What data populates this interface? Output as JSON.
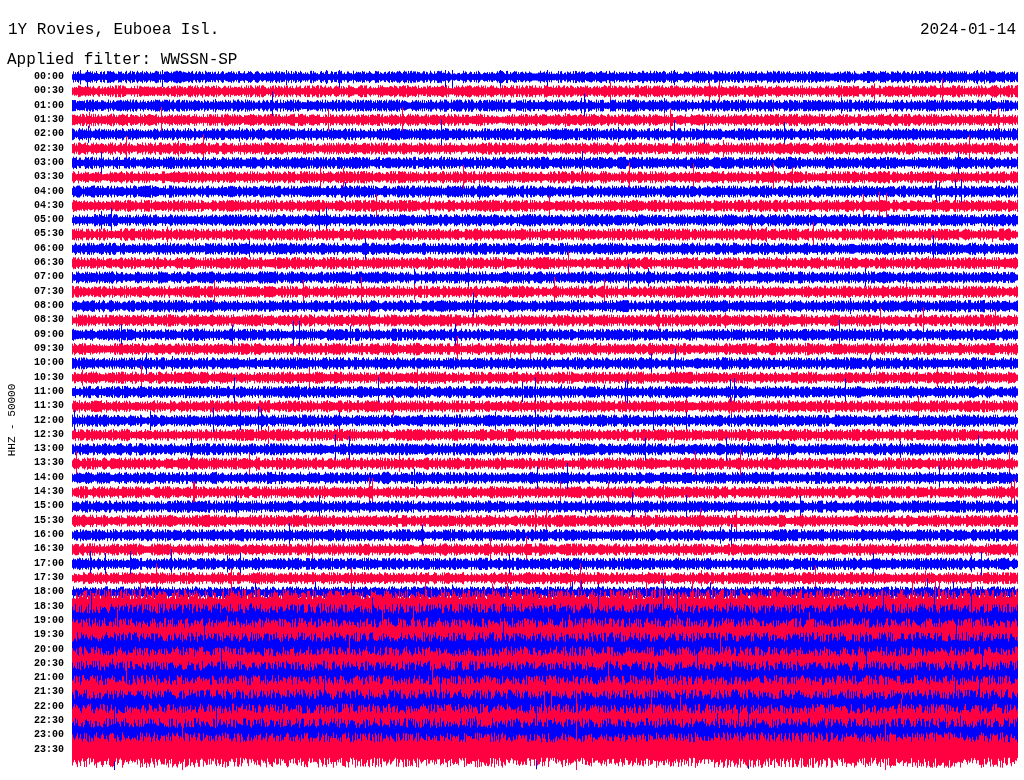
{
  "header": {
    "station": "1Y Rovies, Euboea Isl.",
    "date": "2024-01-14",
    "filter": "Applied filter: WWSSN-SP"
  },
  "channel_label": "HHZ - 50000",
  "rows": [
    {
      "label": "00:00",
      "color": "#0000ff"
    },
    {
      "label": "00:30",
      "color": "#ff0040"
    },
    {
      "label": "01:00",
      "color": "#0000ff"
    },
    {
      "label": "01:30",
      "color": "#ff0040"
    },
    {
      "label": "02:00",
      "color": "#0000ff"
    },
    {
      "label": "02:30",
      "color": "#ff0040"
    },
    {
      "label": "03:00",
      "color": "#0000ff"
    },
    {
      "label": "03:30",
      "color": "#ff0040"
    },
    {
      "label": "04:00",
      "color": "#0000ff"
    },
    {
      "label": "04:30",
      "color": "#ff0040"
    },
    {
      "label": "05:00",
      "color": "#0000ff"
    },
    {
      "label": "05:30",
      "color": "#ff0040"
    },
    {
      "label": "06:00",
      "color": "#0000ff"
    },
    {
      "label": "06:30",
      "color": "#ff0040"
    },
    {
      "label": "07:00",
      "color": "#0000ff"
    },
    {
      "label": "07:30",
      "color": "#ff0040"
    },
    {
      "label": "08:00",
      "color": "#0000ff"
    },
    {
      "label": "08:30",
      "color": "#ff0040"
    },
    {
      "label": "09:00",
      "color": "#0000ff"
    },
    {
      "label": "09:30",
      "color": "#ff0040"
    },
    {
      "label": "10:00",
      "color": "#0000ff"
    },
    {
      "label": "10:30",
      "color": "#ff0040"
    },
    {
      "label": "11:00",
      "color": "#0000ff"
    },
    {
      "label": "11:30",
      "color": "#ff0040"
    },
    {
      "label": "12:00",
      "color": "#0000ff"
    },
    {
      "label": "12:30",
      "color": "#ff0040"
    },
    {
      "label": "13:00",
      "color": "#0000ff"
    },
    {
      "label": "13:30",
      "color": "#ff0040"
    },
    {
      "label": "14:00",
      "color": "#0000ff"
    },
    {
      "label": "14:30",
      "color": "#ff0040"
    },
    {
      "label": "15:00",
      "color": "#0000ff"
    },
    {
      "label": "15:30",
      "color": "#ff0040"
    },
    {
      "label": "16:00",
      "color": "#0000ff"
    },
    {
      "label": "16:30",
      "color": "#ff0040"
    },
    {
      "label": "17:00",
      "color": "#0000ff"
    },
    {
      "label": "17:30",
      "color": "#ff0040"
    },
    {
      "label": "18:00",
      "color": "#0000ff"
    },
    {
      "label": "18:30",
      "color": "#ff0040"
    },
    {
      "label": "19:00",
      "color": "#0000ff"
    },
    {
      "label": "19:30",
      "color": "#ff0040"
    },
    {
      "label": "20:00",
      "color": "#0000ff"
    },
    {
      "label": "20:30",
      "color": "#ff0040"
    },
    {
      "label": "21:00",
      "color": "#0000ff"
    },
    {
      "label": "21:30",
      "color": "#ff0040"
    },
    {
      "label": "22:00",
      "color": "#0000ff"
    },
    {
      "label": "22:30",
      "color": "#ff0040"
    },
    {
      "label": "23:00",
      "color": "#0000ff"
    },
    {
      "label": "23:30",
      "color": "#ff0040"
    }
  ]
}
